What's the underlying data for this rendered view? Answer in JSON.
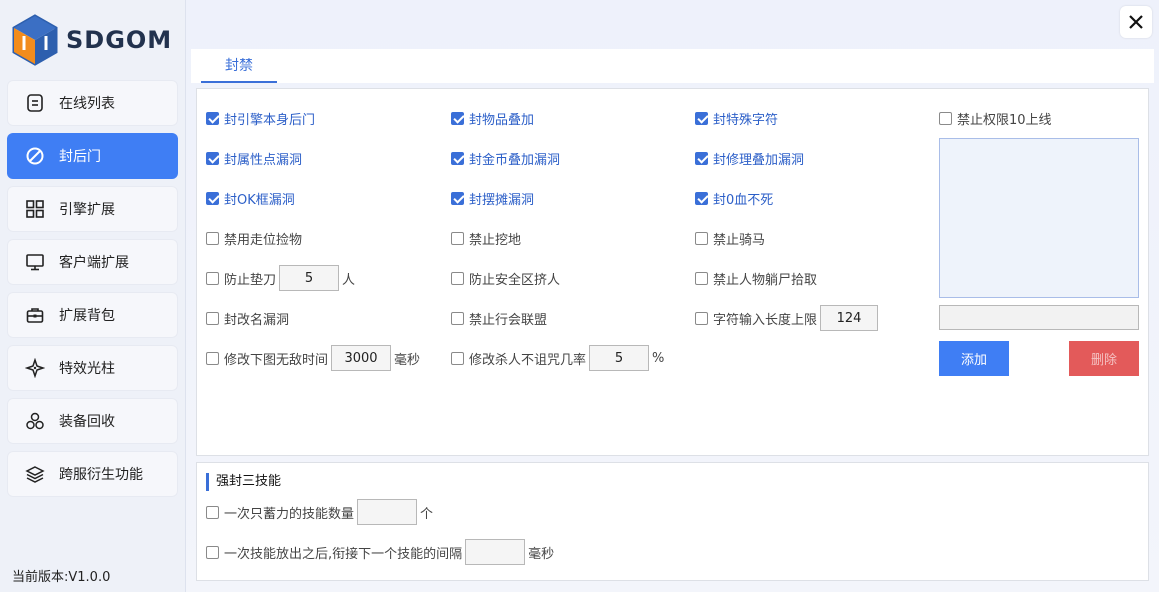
{
  "brand": {
    "name": "SDGOM"
  },
  "sidebar": {
    "items": [
      {
        "label": "在线列表",
        "icon": "list-icon"
      },
      {
        "label": "封后门",
        "icon": "ban-icon"
      },
      {
        "label": "引擎扩展",
        "icon": "grid-icon"
      },
      {
        "label": "客户端扩展",
        "icon": "monitor-icon"
      },
      {
        "label": "扩展背包",
        "icon": "bag-icon"
      },
      {
        "label": "特效光柱",
        "icon": "sparkle-icon"
      },
      {
        "label": "装备回收",
        "icon": "recycle-icon"
      },
      {
        "label": "跨服衍生功能",
        "icon": "layers-icon"
      }
    ],
    "active_index": 1,
    "version": "当前版本:V1.0.0"
  },
  "tabs": [
    {
      "label": "封禁"
    }
  ],
  "options": {
    "col1": [
      {
        "label": "封引擎本身后门",
        "checked": true
      },
      {
        "label": "封属性点漏洞",
        "checked": true
      },
      {
        "label": "封OK框漏洞",
        "checked": true
      },
      {
        "label": "禁用走位捡物",
        "checked": false
      },
      {
        "label": "防止垫刀",
        "checked": false,
        "value": "5",
        "suffix": "人"
      },
      {
        "label": "封改名漏洞",
        "checked": false
      },
      {
        "label": "修改下图无敌时间",
        "checked": false,
        "value": "3000",
        "suffix": "毫秒"
      }
    ],
    "col2": [
      {
        "label": "封物品叠加",
        "checked": true
      },
      {
        "label": "封金币叠加漏洞",
        "checked": true
      },
      {
        "label": "封摆摊漏洞",
        "checked": true
      },
      {
        "label": "禁止挖地",
        "checked": false
      },
      {
        "label": "防止安全区挤人",
        "checked": false
      },
      {
        "label": "禁止行会联盟",
        "checked": false
      },
      {
        "label": "修改杀人不诅咒几率",
        "checked": false,
        "value": "5",
        "suffix": "%"
      }
    ],
    "col3": [
      {
        "label": "封特殊字符",
        "checked": true
      },
      {
        "label": "封修理叠加漏洞",
        "checked": true
      },
      {
        "label": "封0血不死",
        "checked": true
      },
      {
        "label": "禁止骑马",
        "checked": false
      },
      {
        "label": "禁止人物躺尸拾取",
        "checked": false
      },
      {
        "label": "字符输入长度上限",
        "checked": false,
        "value": "124"
      }
    ]
  },
  "side": {
    "checkbox_label": "禁止权限10上线",
    "checked": false,
    "add_label": "添加",
    "delete_label": "删除",
    "input_value": ""
  },
  "skill": {
    "title": "强封三技能",
    "row1": {
      "label": "一次只蓄力的技能数量",
      "value": "",
      "suffix": "个",
      "checked": false
    },
    "row2": {
      "label": "一次技能放出之后,衔接下一个技能的间隔",
      "value": "",
      "suffix": "毫秒",
      "checked": false
    }
  },
  "colors": {
    "accent": "#3f7ef4",
    "danger": "#e35a5a",
    "check": "#3a6fd8"
  }
}
